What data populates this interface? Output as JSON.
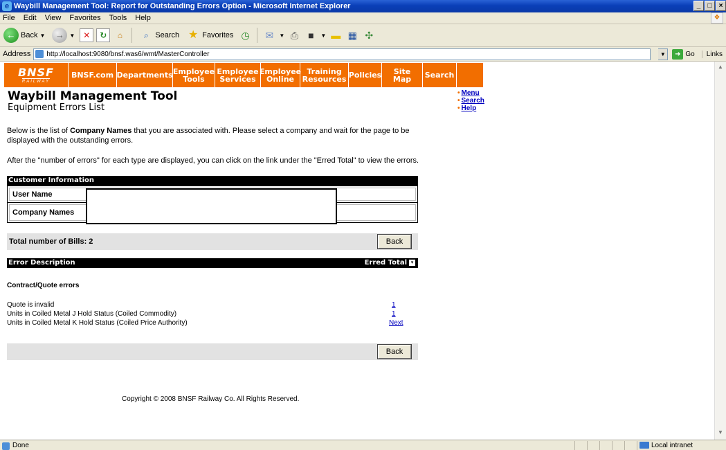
{
  "window": {
    "title": "Waybill Management Tool: Report for Outstanding Errors Option - Microsoft Internet Explorer"
  },
  "menu": [
    "File",
    "Edit",
    "View",
    "Favorites",
    "Tools",
    "Help"
  ],
  "toolbar": {
    "back_label": "Back",
    "search_label": "Search",
    "favorites_label": "Favorites"
  },
  "address": {
    "label": "Address",
    "url": "http://localhost:9080/bnsf.was6/wmt/MasterController",
    "go_label": "Go",
    "links_label": "Links"
  },
  "bnsf_nav": {
    "logo_text": "BNSF",
    "logo_sub": "RAILWAY",
    "brand_color": "#f26e00",
    "items": [
      "BNSF.com",
      "Departments",
      "Employee Tools",
      "Employee Services",
      "Employee Online",
      "Training Resources",
      "Policies",
      "Site Map",
      "Search"
    ]
  },
  "page": {
    "title": "Waybill Management Tool",
    "subtitle": "Equipment Errors List",
    "side_links": [
      "Menu",
      "Search",
      "Help"
    ],
    "intro_prefix": "Below is the list of ",
    "intro_bold": "Company Names",
    "intro_suffix": " that you are associated with. Please select a company and wait for the page to be displayed with the outstanding errors.",
    "intro2": "After the \"number of errors\" for each type are displayed, you can click on the link under the \"Erred Total\" to view the errors."
  },
  "customer_info": {
    "header": "Customer Information",
    "rows": [
      "User Name",
      "Company Names"
    ]
  },
  "bills": {
    "total_label": "Total number of Bills: 2",
    "back_label": "Back"
  },
  "errors": {
    "header_left": "Error Description",
    "header_right": "Erred Total",
    "section_title": "Contract/Quote errors",
    "rows": [
      {
        "description": "Quote is invalid",
        "link": "1"
      },
      {
        "description": "Units in Coiled Metal J Hold Status (Coiled Commodity)",
        "link": "1"
      },
      {
        "description": "Units in Coiled Metal K Hold Status (Coiled Price Authority)",
        "link": "Next"
      }
    ],
    "back_label": "Back"
  },
  "copyright": "Copyright © 2008 BNSF Railway Co. All Rights Reserved.",
  "status": {
    "left": "Done",
    "zone": "Local intranet"
  }
}
